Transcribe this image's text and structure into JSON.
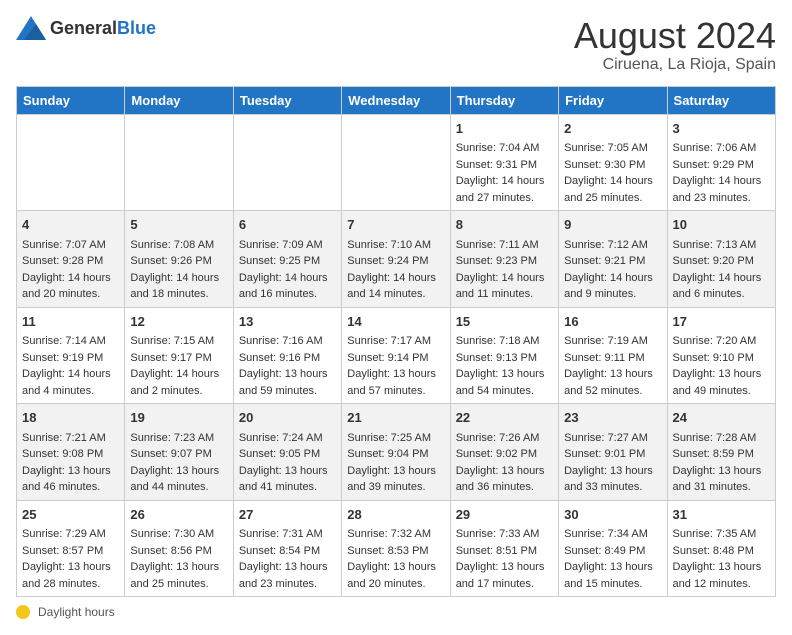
{
  "header": {
    "logo": {
      "general": "General",
      "blue": "Blue"
    },
    "title": "August 2024",
    "subtitle": "Ciruena, La Rioja, Spain"
  },
  "days_of_week": [
    "Sunday",
    "Monday",
    "Tuesday",
    "Wednesday",
    "Thursday",
    "Friday",
    "Saturday"
  ],
  "weeks": [
    [
      {
        "day": "",
        "detail": ""
      },
      {
        "day": "",
        "detail": ""
      },
      {
        "day": "",
        "detail": ""
      },
      {
        "day": "",
        "detail": ""
      },
      {
        "day": "1",
        "detail": "Sunrise: 7:04 AM\nSunset: 9:31 PM\nDaylight: 14 hours\nand 27 minutes."
      },
      {
        "day": "2",
        "detail": "Sunrise: 7:05 AM\nSunset: 9:30 PM\nDaylight: 14 hours\nand 25 minutes."
      },
      {
        "day": "3",
        "detail": "Sunrise: 7:06 AM\nSunset: 9:29 PM\nDaylight: 14 hours\nand 23 minutes."
      }
    ],
    [
      {
        "day": "4",
        "detail": "Sunrise: 7:07 AM\nSunset: 9:28 PM\nDaylight: 14 hours\nand 20 minutes."
      },
      {
        "day": "5",
        "detail": "Sunrise: 7:08 AM\nSunset: 9:26 PM\nDaylight: 14 hours\nand 18 minutes."
      },
      {
        "day": "6",
        "detail": "Sunrise: 7:09 AM\nSunset: 9:25 PM\nDaylight: 14 hours\nand 16 minutes."
      },
      {
        "day": "7",
        "detail": "Sunrise: 7:10 AM\nSunset: 9:24 PM\nDaylight: 14 hours\nand 14 minutes."
      },
      {
        "day": "8",
        "detail": "Sunrise: 7:11 AM\nSunset: 9:23 PM\nDaylight: 14 hours\nand 11 minutes."
      },
      {
        "day": "9",
        "detail": "Sunrise: 7:12 AM\nSunset: 9:21 PM\nDaylight: 14 hours\nand 9 minutes."
      },
      {
        "day": "10",
        "detail": "Sunrise: 7:13 AM\nSunset: 9:20 PM\nDaylight: 14 hours\nand 6 minutes."
      }
    ],
    [
      {
        "day": "11",
        "detail": "Sunrise: 7:14 AM\nSunset: 9:19 PM\nDaylight: 14 hours\nand 4 minutes."
      },
      {
        "day": "12",
        "detail": "Sunrise: 7:15 AM\nSunset: 9:17 PM\nDaylight: 14 hours\nand 2 minutes."
      },
      {
        "day": "13",
        "detail": "Sunrise: 7:16 AM\nSunset: 9:16 PM\nDaylight: 13 hours\nand 59 minutes."
      },
      {
        "day": "14",
        "detail": "Sunrise: 7:17 AM\nSunset: 9:14 PM\nDaylight: 13 hours\nand 57 minutes."
      },
      {
        "day": "15",
        "detail": "Sunrise: 7:18 AM\nSunset: 9:13 PM\nDaylight: 13 hours\nand 54 minutes."
      },
      {
        "day": "16",
        "detail": "Sunrise: 7:19 AM\nSunset: 9:11 PM\nDaylight: 13 hours\nand 52 minutes."
      },
      {
        "day": "17",
        "detail": "Sunrise: 7:20 AM\nSunset: 9:10 PM\nDaylight: 13 hours\nand 49 minutes."
      }
    ],
    [
      {
        "day": "18",
        "detail": "Sunrise: 7:21 AM\nSunset: 9:08 PM\nDaylight: 13 hours\nand 46 minutes."
      },
      {
        "day": "19",
        "detail": "Sunrise: 7:23 AM\nSunset: 9:07 PM\nDaylight: 13 hours\nand 44 minutes."
      },
      {
        "day": "20",
        "detail": "Sunrise: 7:24 AM\nSunset: 9:05 PM\nDaylight: 13 hours\nand 41 minutes."
      },
      {
        "day": "21",
        "detail": "Sunrise: 7:25 AM\nSunset: 9:04 PM\nDaylight: 13 hours\nand 39 minutes."
      },
      {
        "day": "22",
        "detail": "Sunrise: 7:26 AM\nSunset: 9:02 PM\nDaylight: 13 hours\nand 36 minutes."
      },
      {
        "day": "23",
        "detail": "Sunrise: 7:27 AM\nSunset: 9:01 PM\nDaylight: 13 hours\nand 33 minutes."
      },
      {
        "day": "24",
        "detail": "Sunrise: 7:28 AM\nSunset: 8:59 PM\nDaylight: 13 hours\nand 31 minutes."
      }
    ],
    [
      {
        "day": "25",
        "detail": "Sunrise: 7:29 AM\nSunset: 8:57 PM\nDaylight: 13 hours\nand 28 minutes."
      },
      {
        "day": "26",
        "detail": "Sunrise: 7:30 AM\nSunset: 8:56 PM\nDaylight: 13 hours\nand 25 minutes."
      },
      {
        "day": "27",
        "detail": "Sunrise: 7:31 AM\nSunset: 8:54 PM\nDaylight: 13 hours\nand 23 minutes."
      },
      {
        "day": "28",
        "detail": "Sunrise: 7:32 AM\nSunset: 8:53 PM\nDaylight: 13 hours\nand 20 minutes."
      },
      {
        "day": "29",
        "detail": "Sunrise: 7:33 AM\nSunset: 8:51 PM\nDaylight: 13 hours\nand 17 minutes."
      },
      {
        "day": "30",
        "detail": "Sunrise: 7:34 AM\nSunset: 8:49 PM\nDaylight: 13 hours\nand 15 minutes."
      },
      {
        "day": "31",
        "detail": "Sunrise: 7:35 AM\nSunset: 8:48 PM\nDaylight: 13 hours\nand 12 minutes."
      }
    ]
  ],
  "footer": {
    "daylight_label": "Daylight hours"
  }
}
